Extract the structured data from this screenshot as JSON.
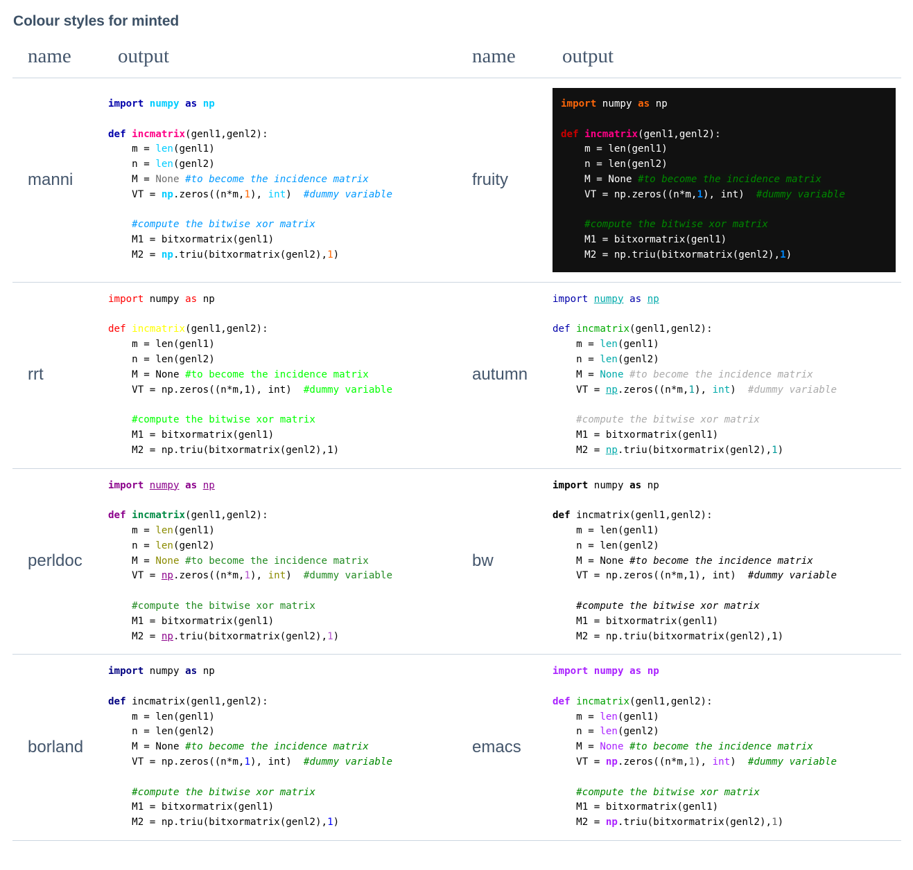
{
  "page": {
    "title": "Colour styles for minted"
  },
  "table": {
    "headers": [
      "name",
      "output",
      "name",
      "output"
    ],
    "rows": [
      {
        "left": {
          "name": "manni",
          "style_key": "manni"
        },
        "right": {
          "name": "fruity",
          "style_key": "fruity"
        }
      },
      {
        "left": {
          "name": "rrt",
          "style_key": "rrt"
        },
        "right": {
          "name": "autumn",
          "style_key": "autumn"
        }
      },
      {
        "left": {
          "name": "perldoc",
          "style_key": "perldoc"
        },
        "right": {
          "name": "bw",
          "style_key": "bw"
        }
      },
      {
        "left": {
          "name": "borland",
          "style_key": "borland"
        },
        "right": {
          "name": "emacs",
          "style_key": "emacs"
        }
      }
    ]
  },
  "code": {
    "language": "python",
    "lines": [
      "import numpy as np",
      "",
      "def incmatrix(genl1,genl2):",
      "    m = len(genl1)",
      "    n = len(genl2)",
      "    M = None #to become the incidence matrix",
      "    VT = np.zeros((n*m,1), int)  #dummy variable",
      "",
      "    #compute the bitwise xor matrix",
      "    M1 = bitxormatrix(genl1)",
      "    M2 = np.triu(bitxormatrix(genl2),1)"
    ],
    "tokens": {
      "keyword_import": "import",
      "keyword_as": "as",
      "keyword_def": "def",
      "module_numpy": "numpy",
      "module_np": "np",
      "function_name": "incmatrix",
      "builtin_len": "len",
      "builtin_int": "int",
      "constant_none": "None",
      "number_one": "1",
      "comment_1": "#to become the incidence matrix",
      "comment_2": "#dummy variable",
      "comment_3": "#compute the bitwise xor matrix"
    }
  },
  "styles": {
    "manni": {
      "background": "#ffffff",
      "text": "#000000",
      "keyword": "#0000aa",
      "module": "#00ccff",
      "function": "#ff0086",
      "builtin": "#00ccff",
      "comment": "#0099ff",
      "number": "#ff6600"
    },
    "fruity": {
      "background": "#111111",
      "text": "#ffffff",
      "keyword": "#fb660a",
      "module": "#ffffff",
      "function": "#ff0086",
      "builtin": "#ffffff",
      "comment": "#008800",
      "number": "#0086f7"
    },
    "rrt": {
      "background": "#ffffff",
      "text": "#000000",
      "keyword": "#ff0000",
      "module": "#000000",
      "function": "#ffff00",
      "builtin": "#000000",
      "comment": "#00ff00",
      "number": "#000000"
    },
    "autumn": {
      "background": "#ffffff",
      "text": "#000000",
      "keyword": "#0000aa",
      "module": "#00aaaa",
      "function": "#00aa00",
      "builtin": "#00aaaa",
      "comment": "#aaaaaa",
      "number": "#009999"
    },
    "perldoc": {
      "background": "#ffffff",
      "text": "#000000",
      "keyword": "#8b008b",
      "module": "#8b008b",
      "function": "#008b45",
      "builtin": "#8b8b00",
      "comment": "#228b22",
      "number": "#b452cd"
    },
    "bw": {
      "background": "#ffffff",
      "text": "#000000",
      "keyword": "#000000",
      "module": "#000000",
      "function": "#000000",
      "builtin": "#000000",
      "comment": "#000000",
      "number": "#000000"
    },
    "borland": {
      "background": "#ffffff",
      "text": "#000000",
      "keyword": "#000080",
      "module": "#000000",
      "function": "#000000",
      "builtin": "#000000",
      "comment": "#008800",
      "number": "#0000ff"
    },
    "emacs": {
      "background": "#ffffff",
      "text": "#000000",
      "keyword": "#aa22ff",
      "module": "#aa22ff",
      "function": "#00a000",
      "builtin": "#aa22ff",
      "comment": "#008800",
      "number": "#666666"
    }
  },
  "theme": {
    "page_text": "#44566c",
    "rule": "#ccd6e0"
  }
}
